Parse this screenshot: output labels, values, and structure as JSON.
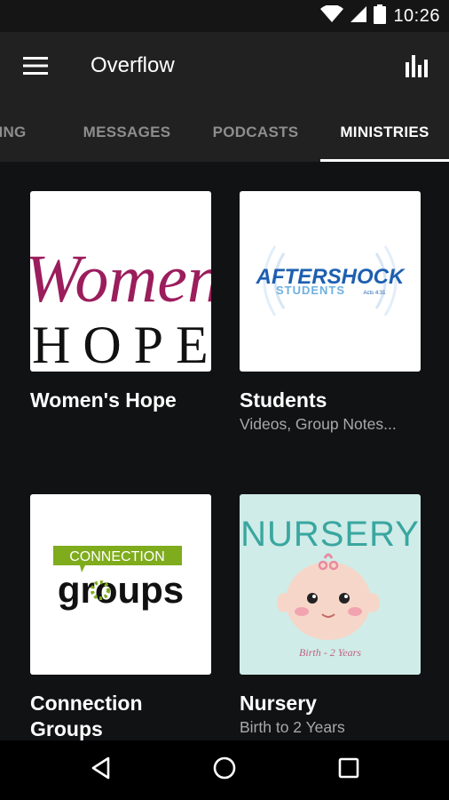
{
  "status_bar": {
    "time": "10:26",
    "icons": [
      "wifi-icon",
      "cell-signal-icon",
      "battery-icon"
    ]
  },
  "app_bar": {
    "title": "Overflow",
    "menu_icon": "hamburger-menu-icon",
    "action_icon": "bar-chart-icon"
  },
  "tabs": [
    {
      "label": "ING",
      "active": false
    },
    {
      "label": "MESSAGES",
      "active": false
    },
    {
      "label": "PODCASTS",
      "active": false
    },
    {
      "label": "MINISTRIES",
      "active": true
    }
  ],
  "cards": [
    {
      "title": "Women's Hope",
      "subtitle": "",
      "art": {
        "line1": "Women",
        "line2": "HOPE"
      }
    },
    {
      "title": "Students",
      "subtitle": "Videos, Group Notes...",
      "art": {
        "brand": "AFTERSHOCK",
        "sub": "STUDENTS",
        "ref": "Acts 4:31"
      }
    },
    {
      "title": "Connection Groups",
      "subtitle": "",
      "art": {
        "banner": "CONNECTION",
        "word": "groups"
      }
    },
    {
      "title": "Nursery",
      "subtitle": "Birth to 2 Years",
      "art": {
        "heading": "NURSERY",
        "caption": "Birth - 2 Years"
      }
    }
  ],
  "nav_bar": {
    "icons": [
      "back-icon",
      "home-icon",
      "recents-icon"
    ]
  },
  "colors": {
    "background": "#111213",
    "toolbar": "#212121",
    "women_magenta": "#9b1d5c",
    "aftershock_blue": "#1e5fb0",
    "connection_green": "#7fac1c",
    "nursery_teal": "#3aa6a0"
  }
}
